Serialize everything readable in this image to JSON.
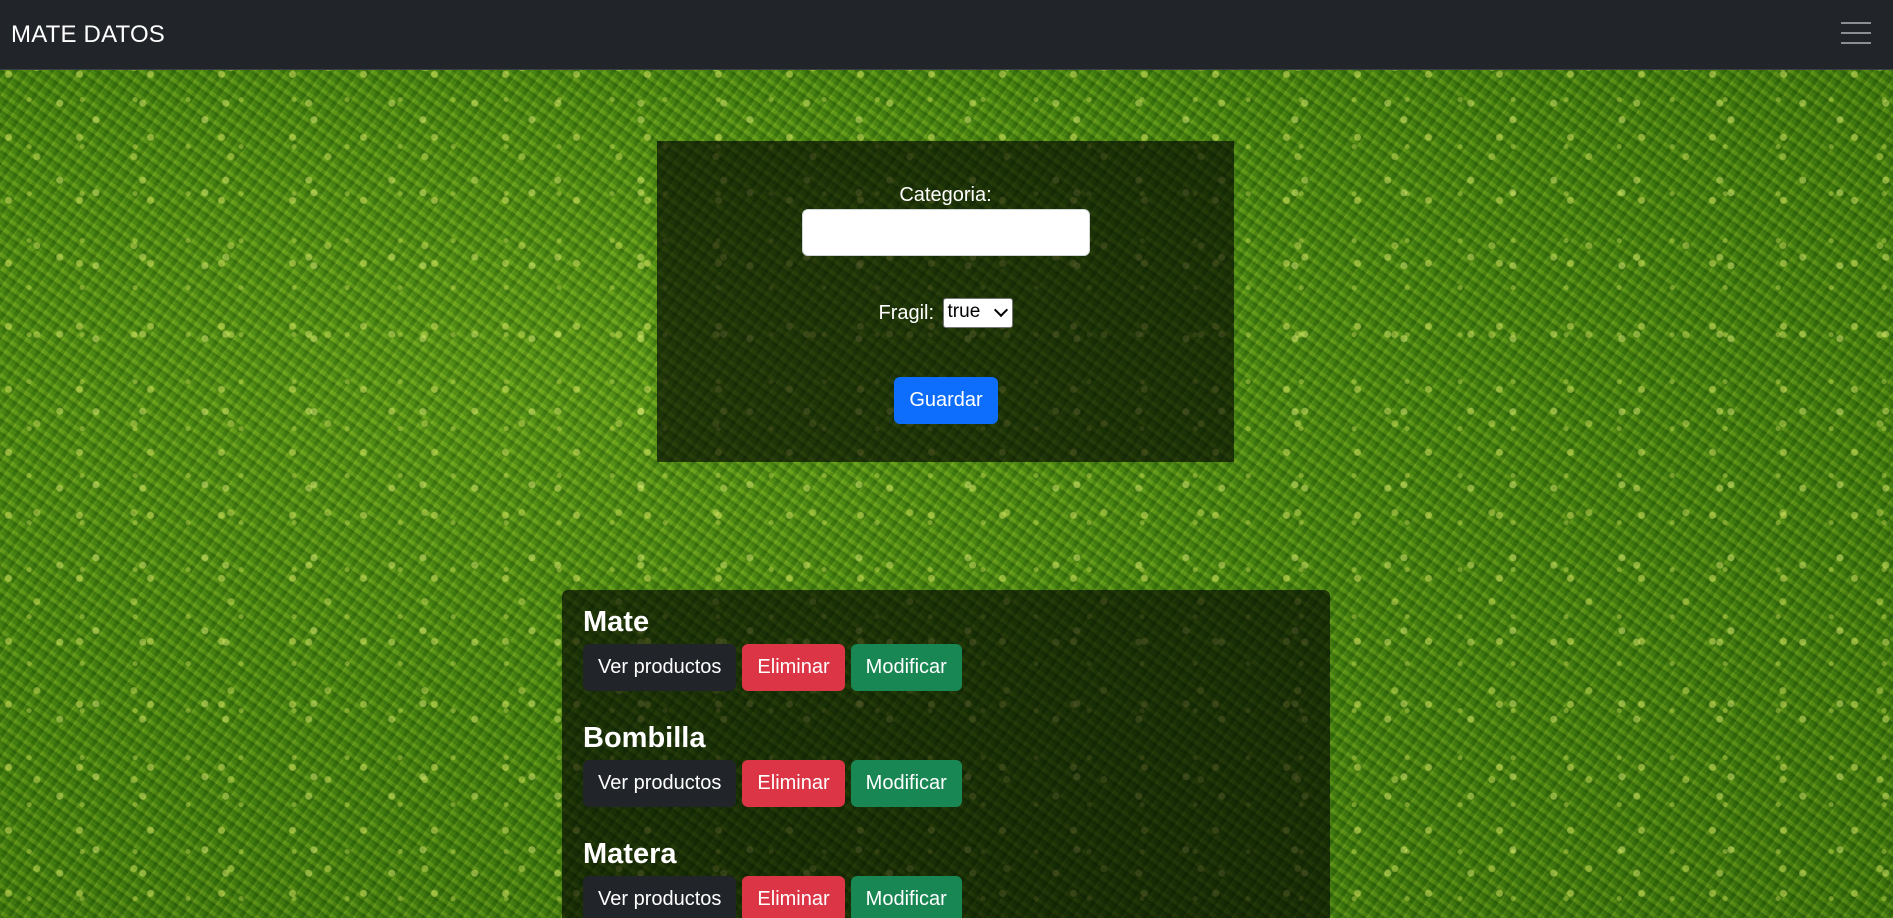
{
  "navbar": {
    "brand": "MATE DATOS",
    "menu_icon": "hamburger-menu-icon"
  },
  "form": {
    "categoria_label": "Categoria:",
    "categoria_value": "",
    "fragil_label": "Fragil:",
    "fragil_selected": "true",
    "save_label": "Guardar"
  },
  "categories": [
    {
      "name": "Mate",
      "view_label": "Ver productos",
      "delete_label": "Eliminar",
      "edit_label": "Modificar"
    },
    {
      "name": "Bombilla",
      "view_label": "Ver productos",
      "delete_label": "Eliminar",
      "edit_label": "Modificar"
    },
    {
      "name": "Matera",
      "view_label": "Ver productos",
      "delete_label": "Eliminar",
      "edit_label": "Modificar"
    }
  ],
  "colors": {
    "navbar_bg": "#212529",
    "primary": "#0d6efd",
    "danger": "#dc3545",
    "success": "#198754",
    "dark": "#212529"
  }
}
